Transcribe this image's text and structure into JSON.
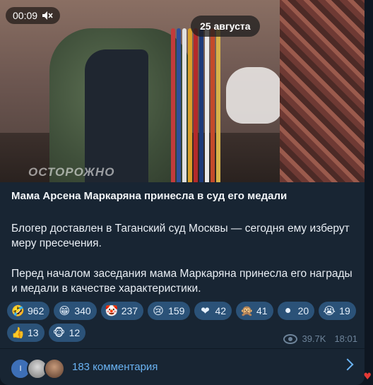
{
  "media": {
    "time": "00:09",
    "mute_icon": "speaker-muted-icon",
    "date": "25 августа",
    "watermark": "ОСТОРОЖНО"
  },
  "post": {
    "title": "Мама Арсена Маркаряна принесла в суд его медали",
    "paragraph1": "Блогер доставлен в Таганский суд Москвы — сегодня ему изберут меру пресечения.",
    "paragraph2": "Перед началом заседания мама Маркаряна принесла его награды и медали в качестве характеристики."
  },
  "reactions": [
    {
      "emoji": "🤣",
      "count": "962",
      "name": "rofl"
    },
    {
      "emoji": "😁",
      "count": "340",
      "name": "grin"
    },
    {
      "emoji": "🤡",
      "count": "237",
      "name": "clown"
    },
    {
      "emoji": "😢",
      "count": "159",
      "name": "cry"
    },
    {
      "emoji": "❤",
      "count": "42",
      "name": "heart"
    },
    {
      "emoji": "🙊",
      "count": "41",
      "name": "monkey"
    },
    {
      "emoji": "⚫",
      "count": "20",
      "name": "circles"
    },
    {
      "emoji": "😭",
      "count": "19",
      "name": "sob"
    },
    {
      "emoji": "👍",
      "count": "13",
      "name": "thumbs-up"
    },
    {
      "emoji": "🐵",
      "count": "12",
      "name": "monkey-face"
    }
  ],
  "meta": {
    "views": "39.7K",
    "time": "18:01"
  },
  "comments": {
    "avatar_initial": "I",
    "label": "183 комментария"
  },
  "colors": {
    "background": "#0e1621",
    "card": "#182533",
    "reaction_pill": "#2b5278",
    "link": "#6ab3f3",
    "meta": "#6d8399"
  }
}
